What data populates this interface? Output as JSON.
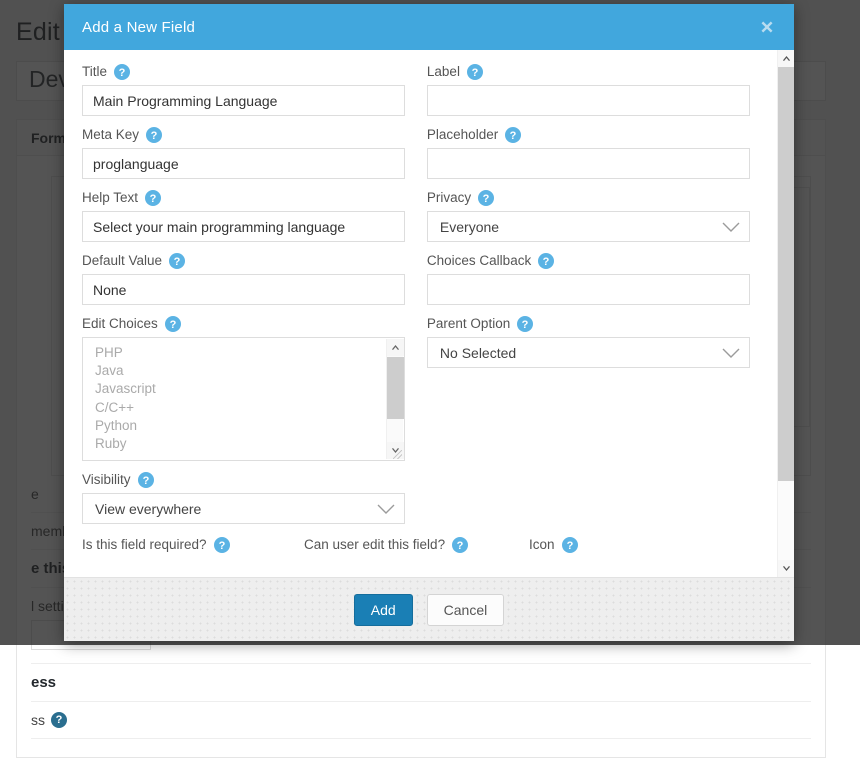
{
  "background": {
    "page_title": "Edit",
    "form_name_value": "Dev",
    "panel_heading": "Form",
    "fragments": [
      {
        "text": "e"
      },
      {
        "text": "member form"
      },
      {
        "text": "e this form"
      },
      {
        "text": "l settings?"
      },
      {
        "text": "ess"
      },
      {
        "text": "ss"
      }
    ]
  },
  "modal": {
    "title": "Add a New Field",
    "close_icon": "close-icon",
    "help_icon": "help-icon",
    "left_column": [
      {
        "label": "Title",
        "name": "title",
        "type": "text",
        "value": "Main Programming Language",
        "placeholder": ""
      },
      {
        "label": "Meta Key",
        "name": "meta-key",
        "type": "text",
        "value": "proglanguage",
        "placeholder": ""
      },
      {
        "label": "Help Text",
        "name": "help-text",
        "type": "text",
        "value": "Select your main programming language",
        "placeholder": ""
      },
      {
        "label": "Default Value",
        "name": "default-value",
        "type": "text",
        "value": "None",
        "placeholder": ""
      }
    ],
    "edit_choices": {
      "label": "Edit Choices",
      "name": "edit-choices",
      "items": [
        "PHP",
        "Java",
        "Javascript",
        "C/C++",
        "Python",
        "Ruby"
      ]
    },
    "visibility": {
      "label": "Visibility",
      "name": "visibility",
      "value": "View everywhere"
    },
    "bottom_row": [
      {
        "label": "Is this field required?",
        "name": "is-field-required"
      },
      {
        "label": "Can user edit this field?",
        "name": "can-user-edit-field"
      },
      {
        "label": "Icon",
        "name": "icon"
      }
    ],
    "right_column": [
      {
        "label": "Label",
        "name": "label",
        "type": "text",
        "value": "",
        "placeholder": ""
      },
      {
        "label": "Placeholder",
        "name": "placeholder",
        "type": "text",
        "value": "",
        "placeholder": ""
      },
      {
        "label": "Privacy",
        "name": "privacy",
        "type": "select",
        "value": "Everyone"
      },
      {
        "label": "Choices Callback",
        "name": "choices-callback",
        "type": "text",
        "value": "",
        "placeholder": ""
      },
      {
        "label": "Parent Option",
        "name": "parent-option",
        "type": "select",
        "value": "No Selected"
      }
    ],
    "footer": {
      "add_label": "Add",
      "cancel_label": "Cancel"
    }
  },
  "colors": {
    "header_blue": "#41a7dd",
    "primary_button": "#1a7fb5",
    "help_icon_blue": "#5bb3e4",
    "overlay": "rgba(30,30,30,0.76)"
  }
}
